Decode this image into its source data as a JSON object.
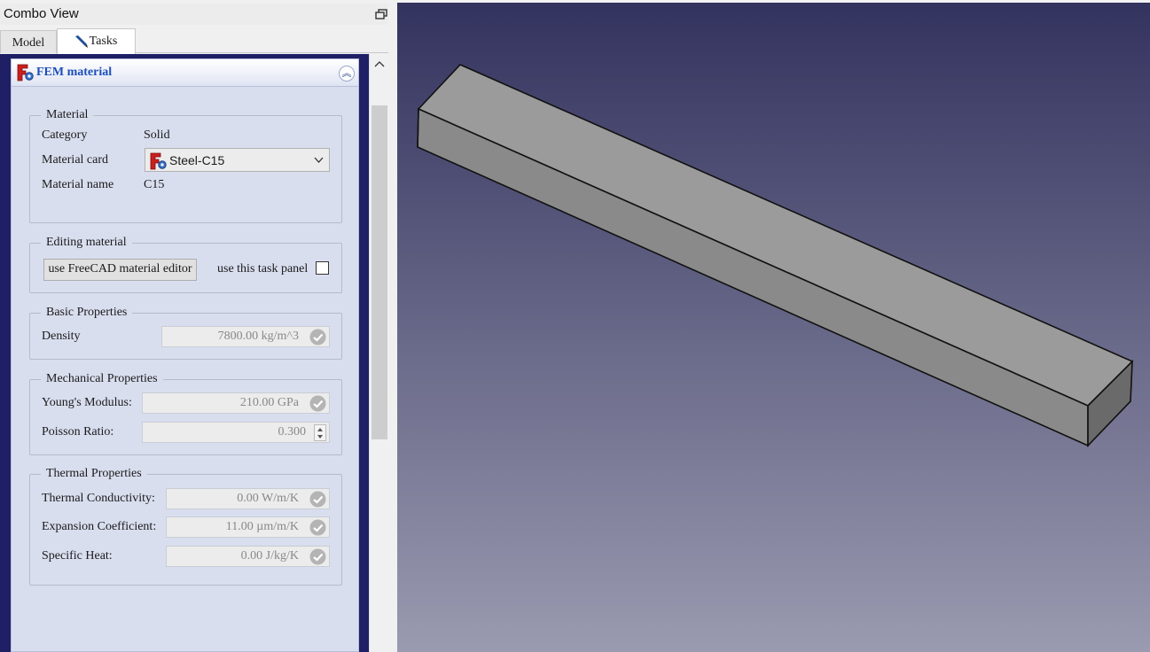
{
  "combo_view": {
    "title": "Combo View",
    "tabs": [
      {
        "label": "Model",
        "active": false
      },
      {
        "label": "Tasks",
        "active": true
      }
    ]
  },
  "task_panel": {
    "title": "FEM material",
    "material": {
      "group_title": "Material",
      "category_label": "Category",
      "category_value": "Solid",
      "card_label": "Material card",
      "card_value": "Steel-C15",
      "name_label": "Material name",
      "name_value": "C15"
    },
    "editing": {
      "group_title": "Editing material",
      "editor_button": "use FreeCAD material editor",
      "task_panel_label": "use this task panel",
      "task_panel_checked": false
    },
    "basic": {
      "group_title": "Basic Properties",
      "density_label": "Density",
      "density_value": "7800.00 kg/m^3"
    },
    "mechanical": {
      "group_title": "Mechanical Properties",
      "youngs_label": "Young's Modulus:",
      "youngs_value": "210.00 GPa",
      "poisson_label": "Poisson Ratio:",
      "poisson_value": "0.300"
    },
    "thermal": {
      "group_title": "Thermal  Properties",
      "conductivity_label": "Thermal Conductivity:",
      "conductivity_value": "0.00 W/m/K",
      "expansion_label": "Expansion Coefficient:",
      "expansion_value": "11.00 µm/m/K",
      "specific_heat_label": "Specific Heat:",
      "specific_heat_value": "0.00 J/kg/K"
    }
  },
  "colors": {
    "viewport_top": "#33335f",
    "viewport_bottom": "#9a9ab0",
    "task_background": "#d9deef",
    "title_blue": "#1d4fb8",
    "fem_red": "#cc1f1f",
    "shape_top": "#9b9b9b",
    "shape_front": "#8a8a8a",
    "shape_end": "#6a6a6a"
  }
}
